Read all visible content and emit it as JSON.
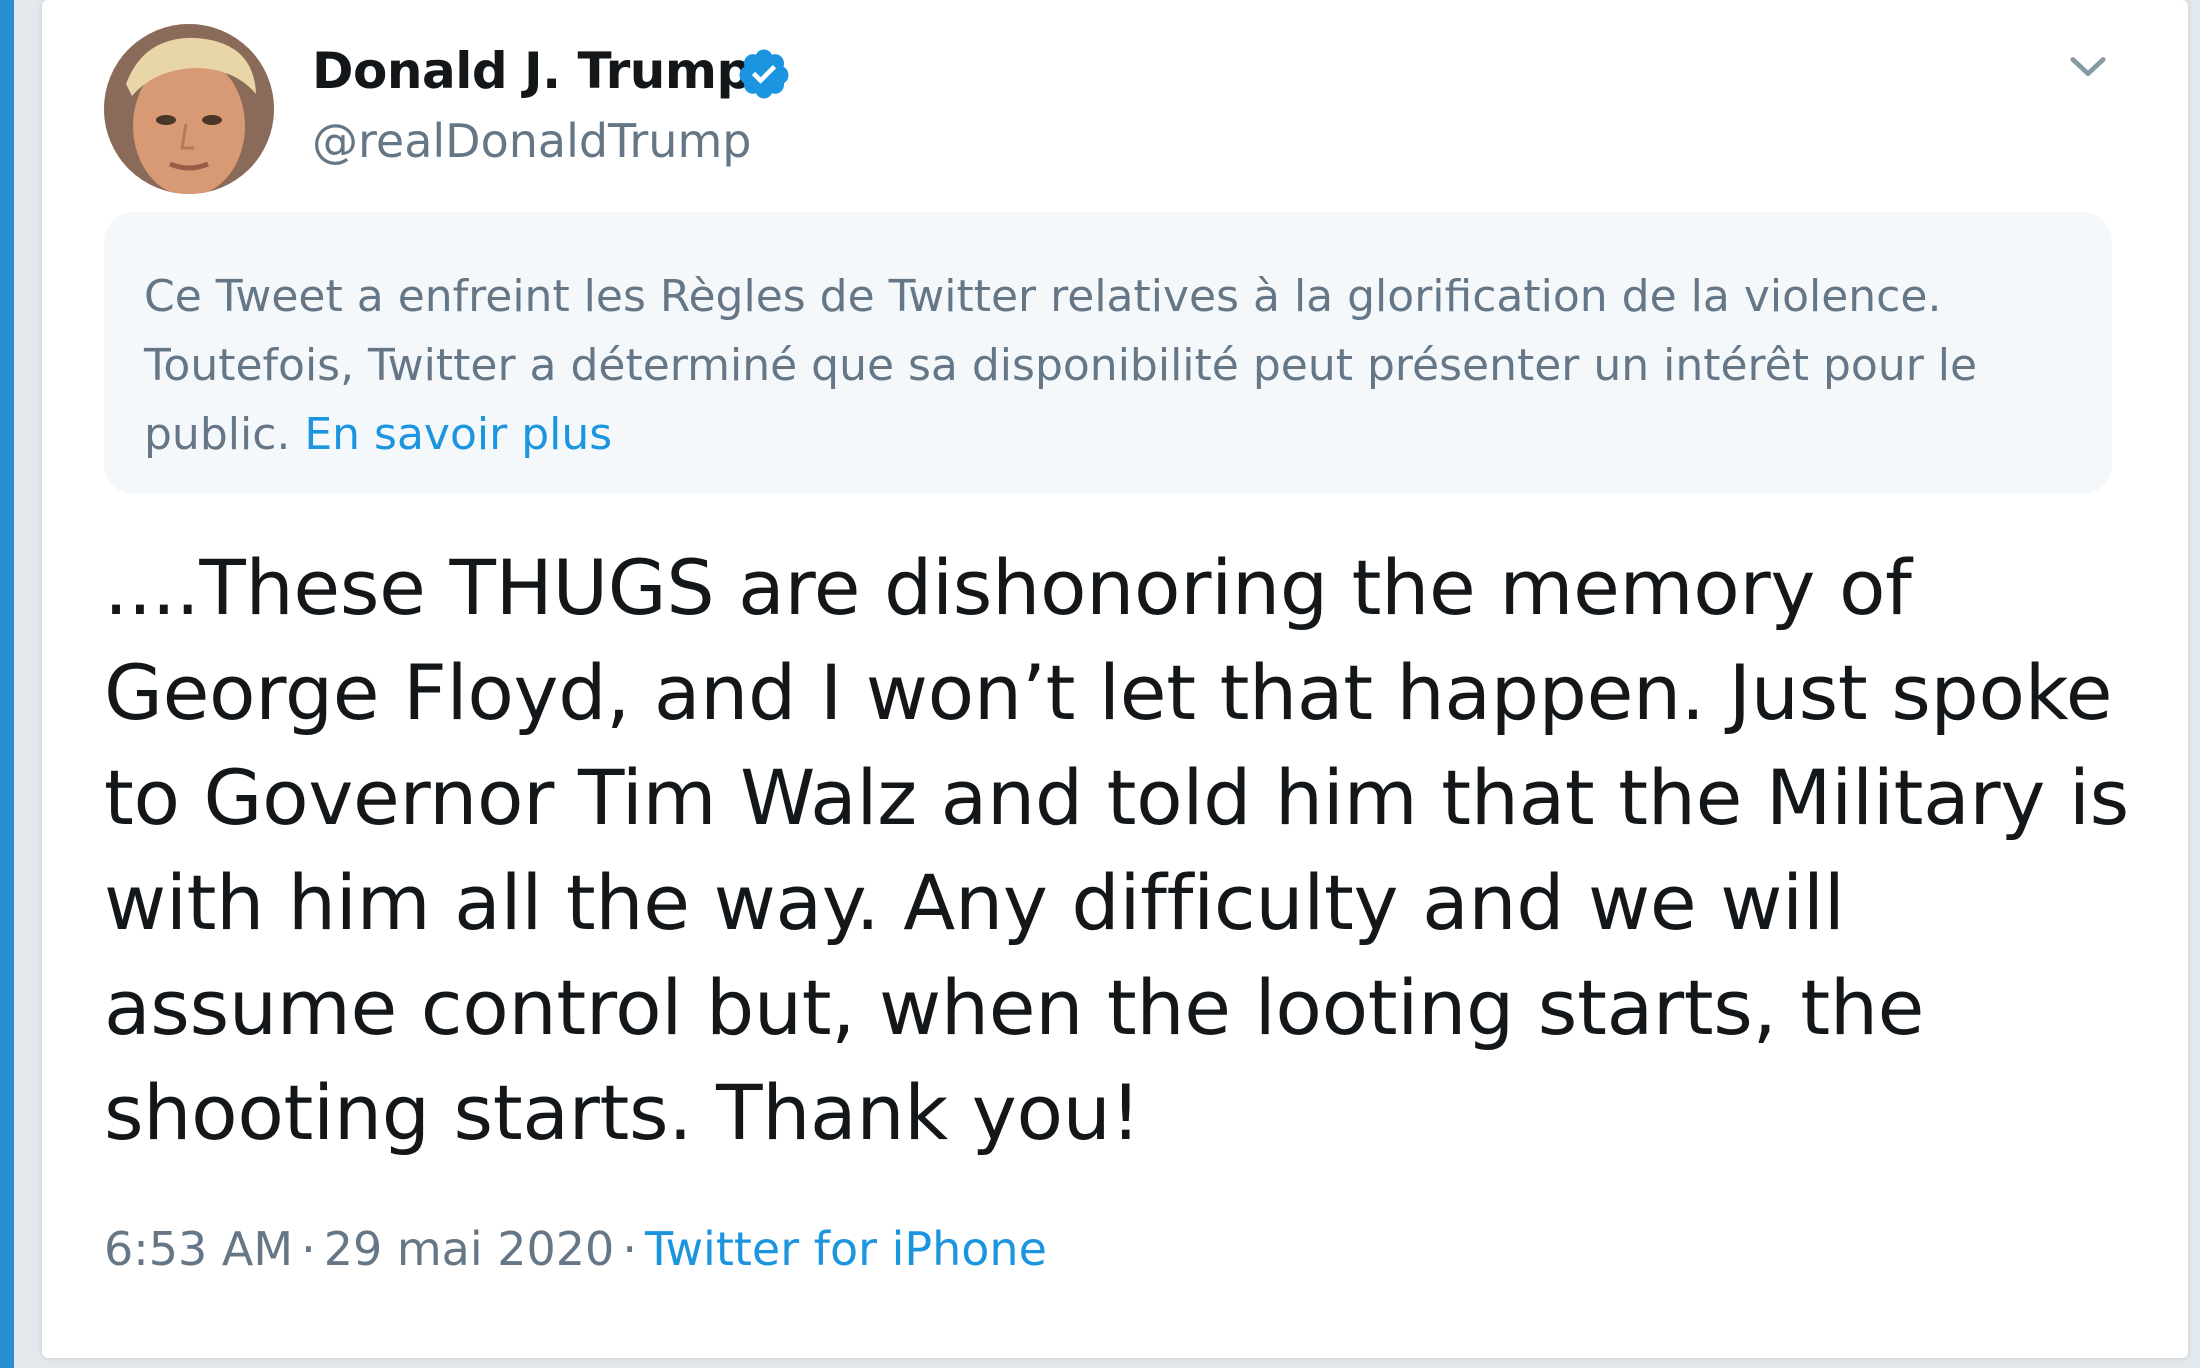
{
  "tweet": {
    "author_name": "Donald J. Trump",
    "author_handle": "@realDonaldTrump",
    "verified": true,
    "notice_text": "Ce Tweet a enfreint les Règles de Twitter relatives à la glorification de la violence. Toutefois, Twitter a déterminé que sa disponibilité peut présenter un intérêt pour le public.",
    "notice_link": "En savoir plus",
    "body": "....These THUGS are dishonoring the memory of George Floyd, and I won’t let that happen. Just spoke to Governor Tim Walz and told him that the Military is with him all the way. Any difficulty and we will assume control but, when the looting starts, the shooting starts. Thank you!",
    "time": "6:53 AM",
    "date": "29 mai 2020",
    "source": "Twitter for iPhone",
    "separator": "·"
  },
  "icons": {
    "verified": "verified-badge-icon",
    "menu": "chevron-down-icon"
  },
  "colors": {
    "accent": "#1b95e0",
    "text": "#14171a",
    "muted": "#657786",
    "notice_bg": "#f5f8fa"
  }
}
